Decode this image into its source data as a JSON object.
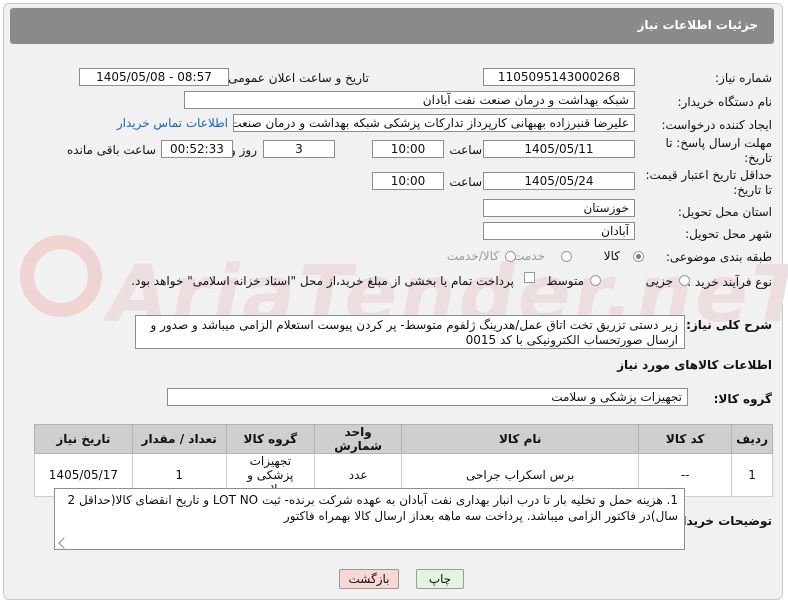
{
  "header": {
    "title": "جزئیات اطلاعات نیاز"
  },
  "watermark": {
    "text": "AriaTender.neT"
  },
  "fields": {
    "need_number_label": "شماره نیاز:",
    "need_number": "1105095143000268",
    "announce_label": "تاریخ و ساعت اعلان عمومی:",
    "announce_value": "1405/05/08 - 08:57",
    "buyer_label": "نام دستگاه خریدار:",
    "buyer_value": "شبکه بهداشت و درمان صنعت نفت آبادان",
    "creator_label": "ایجاد کننده درخواست:",
    "creator_value": "علیرضا قنبرزاده بهبهانی کارپرداز تدارکات پزشکی شبکه بهداشت و درمان صنعت",
    "contact_link": "اطلاعات تماس خریدار",
    "deadline_label_1": "مهلت ارسال پاسخ: تا",
    "deadline_label_2": "تاریخ:",
    "deadline_date": "1405/05/11",
    "time_label": "ساعت",
    "deadline_time": "10:00",
    "days_value": "3",
    "days_label": "روز و",
    "remaining_time": "00:52:33",
    "remaining_label": "ساعت باقی مانده",
    "validity_label_1": "حداقل تاریخ اعتبار قیمت:",
    "validity_label_2": "تا تاریخ:",
    "validity_date": "1405/05/24",
    "validity_time": "10:00",
    "province_label": "استان محل تحویل:",
    "province_value": "خوزستان",
    "city_label": "شهر محل تحویل:",
    "city_value": "آبادان",
    "category_label": "طبقه بندی موضوعی:",
    "category_options": [
      "کالا",
      "خدمت",
      "کالا/خدمت"
    ],
    "category_selected": "کالا",
    "process_label": "نوع فرآیند خرید :",
    "process_options": [
      "جزیی",
      "متوسط"
    ],
    "process_selected": "جزیی",
    "payment_text": "پرداخت تمام یا بخشی از مبلغ خرید،از محل \"اسناد خزانه اسلامی\" خواهد بود."
  },
  "description": {
    "label": "شرح کلی نیاز:",
    "text": "زیر دستی تزریق تخت اتاق عمل/هدرینگ ژلفوم متوسط- پر کردن پیوست استعلام الزامی میباشد و صدور و ارسال صورتحساب الکترونیکی با کد 0015"
  },
  "goods": {
    "section_title": "اطلاعات کالاهای مورد نیاز",
    "group_label": "گروه کالا:",
    "group_value": "تجهیزات پزشکی و سلامت",
    "columns": [
      "ردیف",
      "کد کالا",
      "نام کالا",
      "واحد شمارش",
      "گروه کالا",
      "تعداد / مقدار",
      "تاریخ نیاز"
    ],
    "rows": [
      [
        "1",
        "--",
        "برس اسکراب جراحی",
        "عدد",
        "تجهیزات پزشکی و سلامت",
        "1",
        "1405/05/17"
      ]
    ]
  },
  "buyer_notes": {
    "label": "توضیحات خریدار:",
    "text": "1.    هزینه حمل و تخلیه بار تا درب انبار بهداری نفت آبادان به عهده شرکت برنده- ثبت LOT NO و تاریخ انقضای کالا(حداقل 2 سال)در فاکتور الزامی میباشد. پرداخت سه ماهه بعداز ارسال کالا بهمراه فاکتور"
  },
  "buttons": {
    "print": "چاپ",
    "back": "بازگشت"
  },
  "colors": {
    "header_bg": "#8a8a8a",
    "link": "#1565c0",
    "back_button_bg": "#f8d7d7",
    "print_button_bg": "#e4f3df"
  }
}
